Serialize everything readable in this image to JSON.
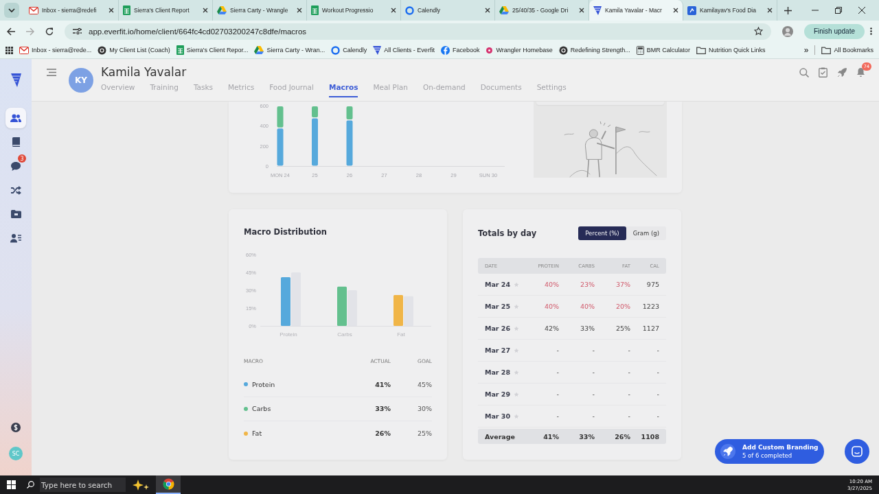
{
  "browser": {
    "tabs": [
      {
        "kind": "mail",
        "title": "Inbox - sierra@redefi",
        "selected": false
      },
      {
        "kind": "sheet",
        "title": "Sierra's Client Report",
        "selected": false
      },
      {
        "kind": "drive",
        "title": "Sierra Carty - Wrangle",
        "selected": false
      },
      {
        "kind": "sheet",
        "title": "Workout Progressio",
        "selected": false
      },
      {
        "kind": "calendly",
        "title": "Calendly",
        "selected": false
      },
      {
        "kind": "drive",
        "title": "25/40/35 - Google Dri",
        "selected": false
      },
      {
        "kind": "everfit",
        "title": "Kamila Yavalar - Macr",
        "selected": true
      },
      {
        "kind": "square",
        "title": "Kamilayav's Food Dia",
        "selected": false
      }
    ],
    "url": "app.everfit.io/home/client/664fc4cd02703200247c8dfe/macros",
    "update_button": "Finish update",
    "bookmarks": [
      {
        "kind": "mail",
        "label": "Inbox - sierra@rede..."
      },
      {
        "kind": "dark",
        "label": "My Client List (Coach)"
      },
      {
        "kind": "sheet",
        "label": "Sierra's Client Repor..."
      },
      {
        "kind": "drive",
        "label": "Sierra Carty - Wran..."
      },
      {
        "kind": "calendly",
        "label": "Calendly"
      },
      {
        "kind": "everfit",
        "label": "All Clients - Everfit"
      },
      {
        "kind": "facebook",
        "label": "Facebook"
      },
      {
        "kind": "pink",
        "label": "Wrangler Homebase"
      },
      {
        "kind": "dark",
        "label": "Redefining Strength..."
      },
      {
        "kind": "calculator",
        "label": "BMR Calculator"
      },
      {
        "kind": "folder",
        "label": "Nutrition Quick Links"
      }
    ],
    "bookmarks_overflow": "»",
    "all_bookmarks": "All Bookmarks"
  },
  "sidebar": {
    "items": [
      {
        "kind": "clients",
        "selected": true
      },
      {
        "kind": "library",
        "selected": false
      },
      {
        "kind": "messages",
        "selected": false,
        "badge": "3"
      },
      {
        "kind": "shuffle",
        "selected": false
      },
      {
        "kind": "folder",
        "selected": false
      },
      {
        "kind": "team",
        "selected": false
      }
    ],
    "bottom": [
      {
        "kind": "billing"
      },
      {
        "kind": "avatar",
        "initials": "SC"
      }
    ]
  },
  "header": {
    "initials": "KY",
    "name": "Kamila Yavalar",
    "tabs": [
      {
        "label": "Overview",
        "selected": false
      },
      {
        "label": "Training",
        "selected": false
      },
      {
        "label": "Tasks",
        "selected": false
      },
      {
        "label": "Metrics",
        "selected": false
      },
      {
        "label": "Food Journal",
        "selected": false
      },
      {
        "label": "Macros",
        "selected": true
      },
      {
        "label": "Meal Plan",
        "selected": false
      },
      {
        "label": "On-demand",
        "selected": false
      },
      {
        "label": "Documents",
        "selected": false
      },
      {
        "label": "Settings",
        "selected": false
      }
    ],
    "notification_count": "74"
  },
  "weekly_chart": {
    "chart_data": {
      "type": "bar",
      "stacked": true,
      "categories": [
        "MON 24",
        "25",
        "26",
        "27",
        "28",
        "29",
        "SUN 30"
      ],
      "ylim": [
        0,
        600
      ],
      "yticks": [
        0,
        200,
        400,
        600
      ],
      "series": [
        {
          "color": "#56a9dc",
          "values": [
            380,
            480,
            460,
            null,
            null,
            null,
            null
          ]
        },
        {
          "color": "#63c08e",
          "values": [
            220,
            120,
            140,
            null,
            null,
            null,
            null
          ]
        }
      ]
    }
  },
  "macro_distribution": {
    "title": "Macro Distribution",
    "chart_data": {
      "type": "bar",
      "categories": [
        "Protein",
        "Carbs",
        "Fat"
      ],
      "ylim": [
        0,
        60
      ],
      "yticks": [
        {
          "value": 0,
          "label": "0%"
        },
        {
          "value": 15,
          "label": "15%"
        },
        {
          "value": 30,
          "label": "30%"
        },
        {
          "value": 45,
          "label": "45%"
        },
        {
          "value": 60,
          "label": "60%"
        }
      ],
      "series": [
        {
          "colors": [
            "#56a9dc",
            "#63c08e",
            "#f0b547"
          ],
          "values": [
            41,
            33,
            26
          ]
        },
        {
          "color": "#e2e3e8",
          "values": [
            45,
            30,
            25
          ]
        }
      ]
    },
    "columns": [
      "MACRO",
      "ACTUAL",
      "GOAL"
    ],
    "rows": [
      {
        "name": "Protein",
        "color": "#56a9dc",
        "actual": "41%",
        "goal": "45%"
      },
      {
        "name": "Carbs",
        "color": "#63c08e",
        "actual": "33%",
        "goal": "30%"
      },
      {
        "name": "Fat",
        "color": "#f0b547",
        "actual": "26%",
        "goal": "25%"
      }
    ]
  },
  "totals_by_day": {
    "title": "Totals by day",
    "units": [
      {
        "label": "Percent (%)",
        "selected": true
      },
      {
        "label": "Gram (g)",
        "selected": false
      }
    ],
    "columns": [
      "DATE",
      "PROTEIN",
      "CARBS",
      "FAT",
      "CAL"
    ],
    "rows": [
      {
        "date": "Mar 24",
        "starred": false,
        "off_target": true,
        "values": [
          "40%",
          "23%",
          "37%",
          "975"
        ]
      },
      {
        "date": "Mar 25",
        "starred": false,
        "off_target": true,
        "values": [
          "40%",
          "40%",
          "20%",
          "1223"
        ]
      },
      {
        "date": "Mar 26",
        "starred": false,
        "off_target": false,
        "values": [
          "42%",
          "33%",
          "25%",
          "1127"
        ]
      },
      {
        "date": "Mar 27",
        "starred": false,
        "off_target": false,
        "values": [
          "-",
          "-",
          "-",
          "-"
        ]
      },
      {
        "date": "Mar 28",
        "starred": false,
        "off_target": false,
        "values": [
          "-",
          "-",
          "-",
          "-"
        ]
      },
      {
        "date": "Mar 29",
        "starred": false,
        "off_target": false,
        "values": [
          "-",
          "-",
          "-",
          "-"
        ]
      },
      {
        "date": "Mar 30",
        "starred": false,
        "off_target": false,
        "values": [
          "-",
          "-",
          "-",
          "-"
        ]
      }
    ],
    "average": {
      "label": "Average",
      "values": [
        "41%",
        "33%",
        "26%",
        "1108"
      ]
    }
  },
  "branding": {
    "title": "Add Custom Branding",
    "progress": "5 of 6 completed"
  },
  "taskbar": {
    "search_placeholder": "Type here to search",
    "time": "10:20 AM",
    "date": "3/27/2025"
  }
}
